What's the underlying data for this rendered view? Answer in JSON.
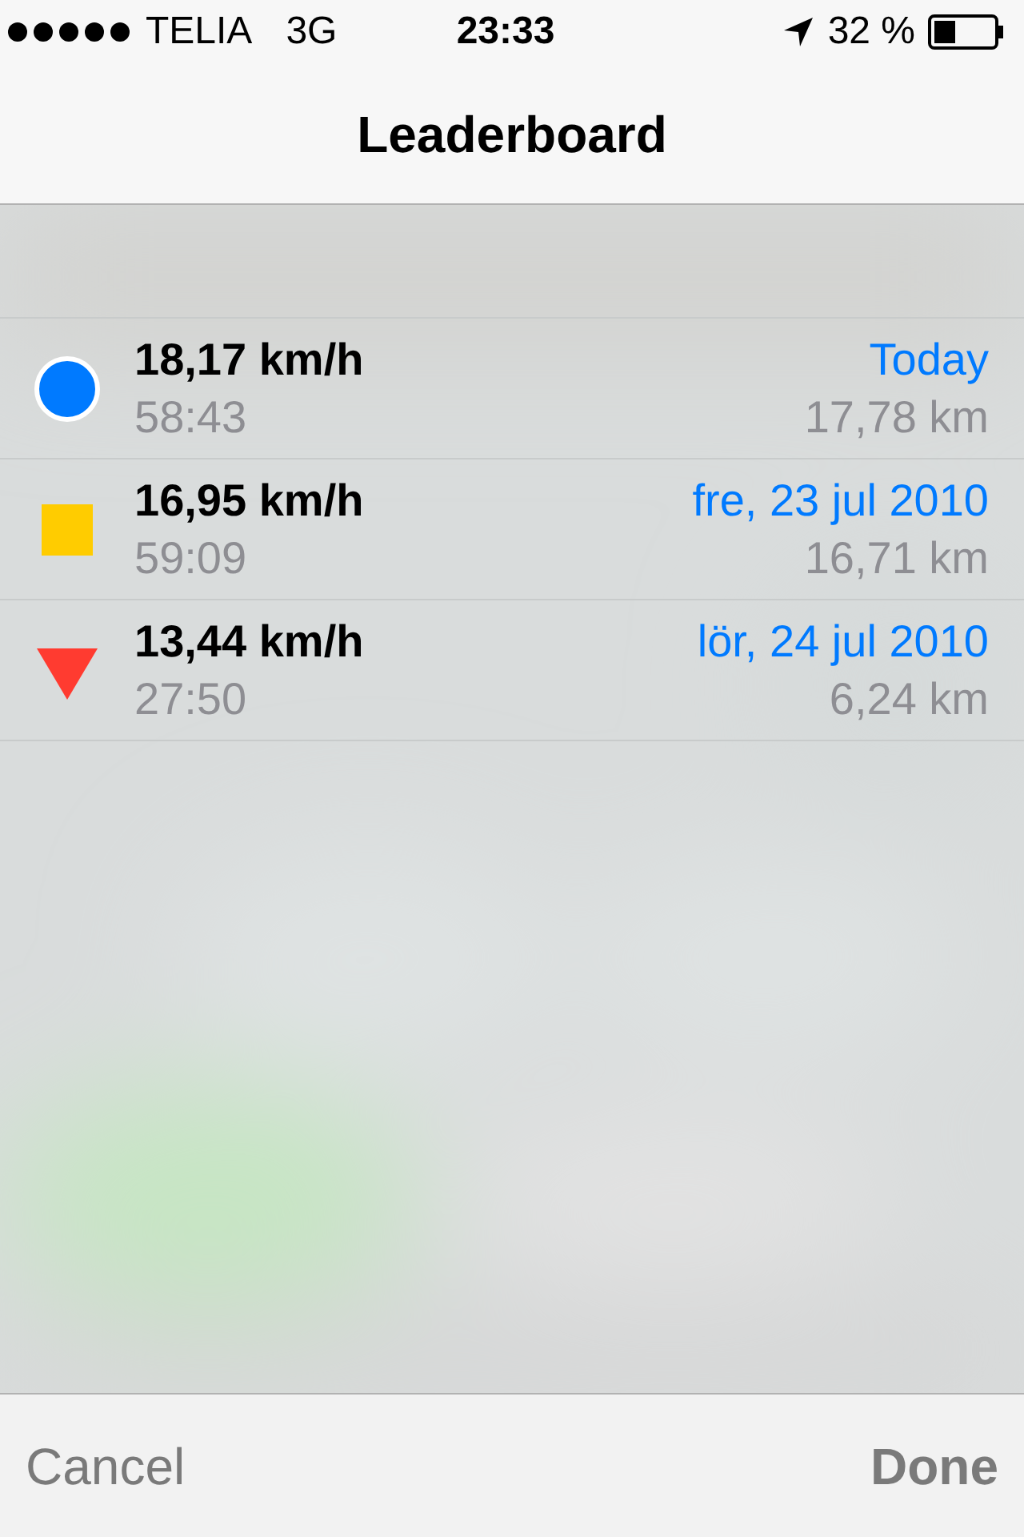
{
  "status_bar": {
    "carrier": "TELIA",
    "network": "3G",
    "time": "23:33",
    "battery": "32 %"
  },
  "nav": {
    "title": "Leaderboard"
  },
  "entries": [
    {
      "kind": "circle",
      "color": "#007aff",
      "speed": "18,17 km/h",
      "duration": "58:43",
      "date": "Today",
      "distance": "17,78 km"
    },
    {
      "kind": "square",
      "color": "#ffcc00",
      "speed": "16,95 km/h",
      "duration": "59:09",
      "date": "fre, 23 jul 2010",
      "distance": "16,71 km"
    },
    {
      "kind": "triangle",
      "color": "#ff3b30",
      "speed": "13,44 km/h",
      "duration": "27:50",
      "date": "lör, 24 jul 2010",
      "distance": "6,24 km"
    }
  ],
  "toolbar": {
    "cancel": "Cancel",
    "done": "Done"
  }
}
